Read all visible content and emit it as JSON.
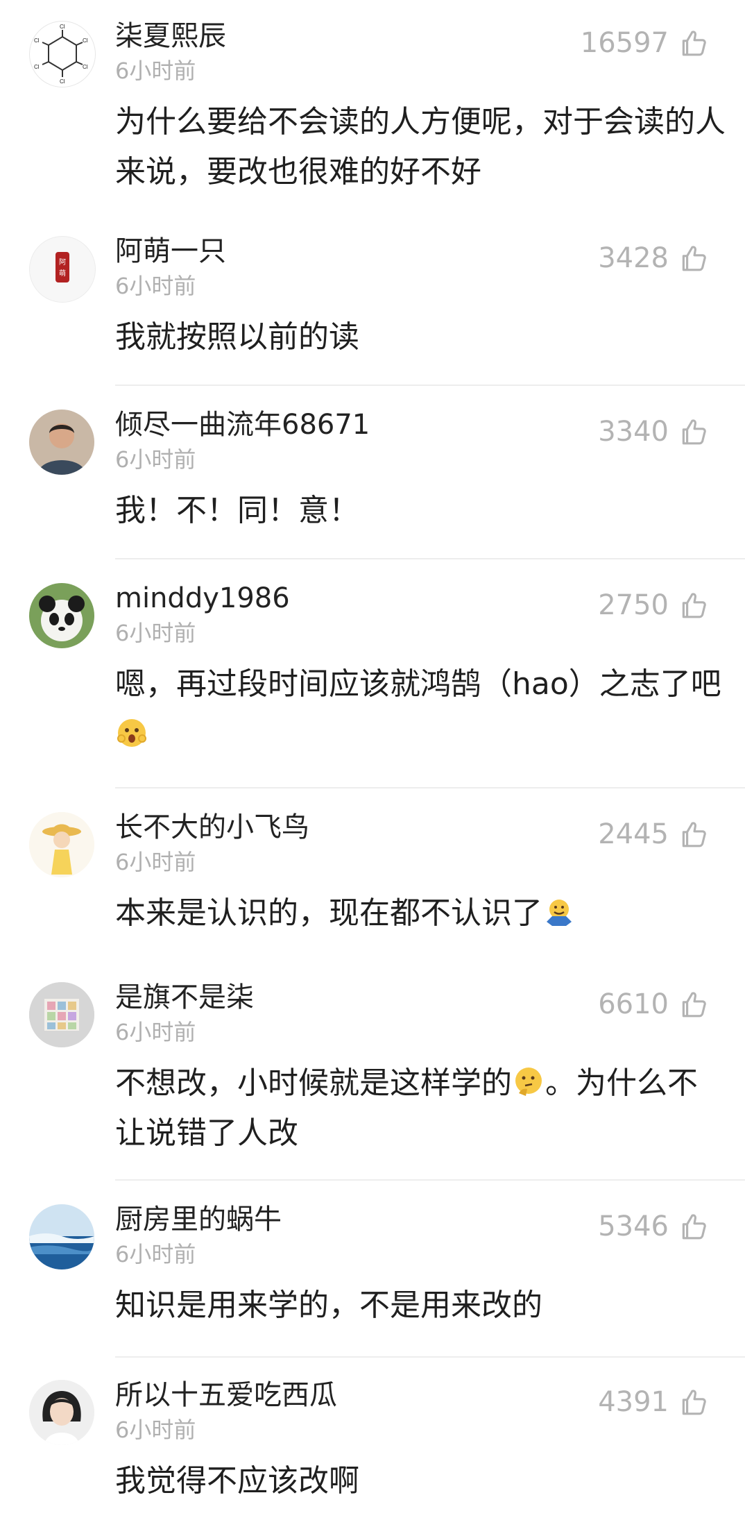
{
  "comments": [
    {
      "username": "柒夏熙辰",
      "time": "6小时前",
      "likes": "16597",
      "text": "为什么要给不会读的人方便呢，对于会读的人来说，要改也很难的好不好"
    },
    {
      "username": "阿萌一只",
      "time": "6小时前",
      "likes": "3428",
      "text": "我就按照以前的读"
    },
    {
      "username": "倾尽一曲流年68671",
      "time": "6小时前",
      "likes": "3340",
      "text": "我！不！同！意！"
    },
    {
      "username": "minddy1986",
      "time": "6小时前",
      "likes": "2750",
      "text": "嗯，再过段时间应该就鸿鹄（hao）之志了吧"
    },
    {
      "username": "长不大的小飞鸟",
      "time": "6小时前",
      "likes": "2445",
      "text": "本来是认识的，现在都不认识了"
    },
    {
      "username": "是旗不是柒",
      "time": "6小时前",
      "likes": "6610",
      "text": "不想改，小时候就是这样学的",
      "text2": "。为什么不让说错了人改"
    },
    {
      "username": "厨房里的蜗牛",
      "time": "6小时前",
      "likes": "5346",
      "text": "知识是用来学的，不是用来改的"
    },
    {
      "username": "所以十五爱吃西瓜",
      "time": "6小时前",
      "likes": "4391",
      "text": "我觉得不应该改啊"
    }
  ],
  "avatar_text": {
    "c2": "阿萌"
  },
  "icons": {
    "like": "thumbs-up-icon"
  }
}
